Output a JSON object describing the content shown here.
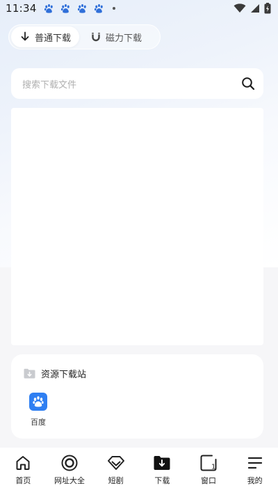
{
  "status_bar": {
    "time": "11:34",
    "notification_icons": [
      "baidu-paw-icon",
      "baidu-paw-icon",
      "baidu-paw-icon",
      "baidu-paw-icon"
    ],
    "right_icons": [
      "wifi-icon",
      "signal-icon",
      "battery-icon"
    ]
  },
  "tabs": [
    {
      "label": "普通下载",
      "icon": "download-arrow-icon",
      "active": true
    },
    {
      "label": "磁力下载",
      "icon": "magnet-icon",
      "active": false
    }
  ],
  "search": {
    "placeholder": "搜索下载文件",
    "icon": "search-icon"
  },
  "resource_section": {
    "title": "资源下载站",
    "icon": "folder-download-icon",
    "sites": [
      {
        "label": "百度",
        "icon": "baidu-icon",
        "color": "#2f7ff2"
      }
    ]
  },
  "bottom_nav": [
    {
      "label": "首页",
      "icon": "home-icon"
    },
    {
      "label": "网址大全",
      "icon": "target-icon"
    },
    {
      "label": "短剧",
      "icon": "gem-icon"
    },
    {
      "label": "下载",
      "icon": "download-folder-icon",
      "active": true
    },
    {
      "label": "窗口",
      "icon": "window-icon",
      "badge": "1"
    },
    {
      "label": "我的",
      "icon": "menu-icon"
    }
  ],
  "colors": {
    "accent": "#2f7ff2",
    "page_background": "#f6f6f8"
  }
}
